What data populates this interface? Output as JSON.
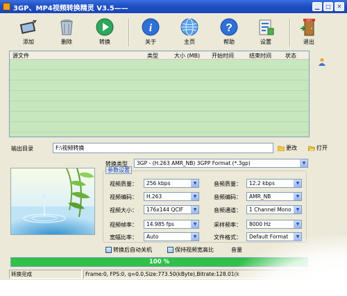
{
  "window": {
    "title": "3GP、MP4视频转换精灵 V3.5——",
    "controls": [
      "min",
      "max",
      "close"
    ]
  },
  "toolbar": {
    "items": [
      {
        "label": "添加",
        "icon": "add-film-icon"
      },
      {
        "label": "删除",
        "icon": "trash-icon"
      },
      {
        "label": "转换",
        "icon": "play-convert-icon"
      },
      {
        "label": "关于",
        "icon": "info-icon"
      },
      {
        "label": "主页",
        "icon": "globe-icon"
      },
      {
        "label": "帮助",
        "icon": "help-icon"
      },
      {
        "label": "设置",
        "icon": "settings-icon"
      },
      {
        "label": "退出",
        "icon": "exit-door-icon"
      }
    ]
  },
  "file_list": {
    "columns": [
      "源文件",
      "类型",
      "大小 (MB)",
      "开始时间",
      "结束时间",
      "状态"
    ],
    "rows": []
  },
  "output": {
    "label": "输出目录",
    "value": "F:\\视频转换",
    "change_label": "更改",
    "open_label": "打开"
  },
  "conversion": {
    "label": "转换类型",
    "value": "3GP - (H.263 AMR_NB) 3GPP Format (*.3gp)"
  },
  "params": {
    "group_title": "参数设置",
    "video_quality": {
      "label": "视频质量：",
      "value": "256 kbps"
    },
    "video_codec": {
      "label": "视频编码：",
      "value": "H.263"
    },
    "video_size": {
      "label": "视频大小：",
      "value": "176x144 QCIF"
    },
    "video_fps": {
      "label": "视频帧率：",
      "value": "14.985 fps"
    },
    "aspect": {
      "label": "宽幅比率：",
      "value": "Auto"
    },
    "audio_quality": {
      "label": "音频质量：",
      "value": "12.2  kbps"
    },
    "audio_codec": {
      "label": "音频编码：",
      "value": "AMR_NB"
    },
    "audio_channel": {
      "label": "音频通道：",
      "value": "1 Channel Mono"
    },
    "sample_rate": {
      "label": "采样频率：",
      "value": "8000  Hz"
    },
    "file_format": {
      "label": "文件格式：",
      "value": "Default Format"
    }
  },
  "options": {
    "shutdown_label": "转换后自动关机",
    "keep_ratio_label": "保持视频宽高比",
    "volume_label": "音量"
  },
  "progress": {
    "text": "100 %",
    "fraction": 1.0,
    "color": "#2fc14a"
  },
  "status": {
    "state": "转换完成",
    "info": "Frame:0, FPS:0, q=0.0,Size:773.50(kByte),Bitrate:128.01(k"
  }
}
